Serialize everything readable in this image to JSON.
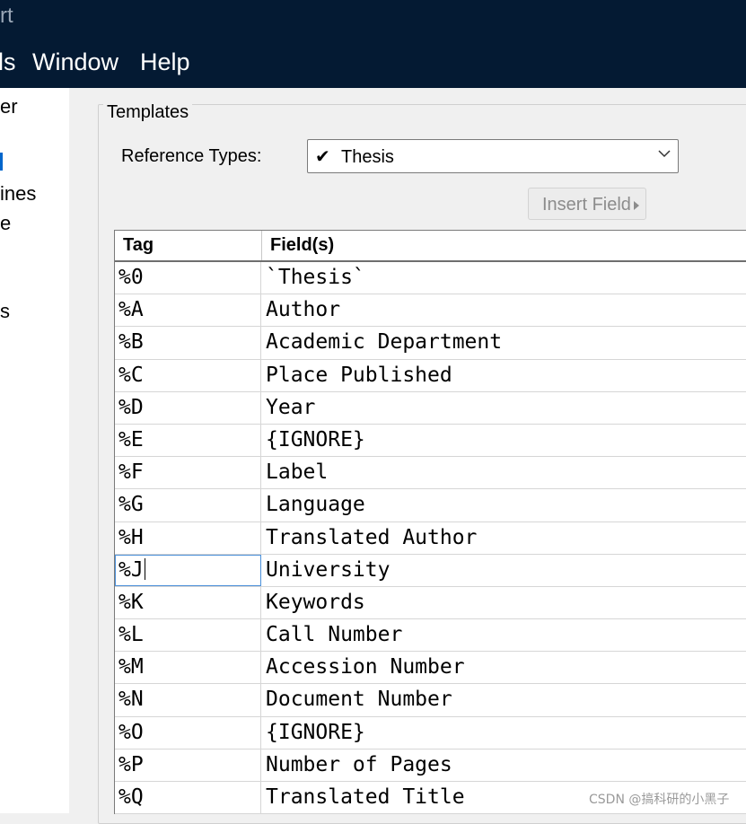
{
  "window": {
    "title_fragment": "rt"
  },
  "menubar": {
    "items": [
      "ls",
      "Window",
      "Help"
    ]
  },
  "sidebar": {
    "items": [
      {
        "label": "er",
        "selected": false
      },
      {
        "label": "",
        "selected": true
      },
      {
        "label": "ines",
        "selected": false
      },
      {
        "label": "e",
        "selected": false
      },
      {
        "label": "s",
        "selected": false
      }
    ]
  },
  "templates": {
    "group_label": "Templates",
    "reference_types_label": "Reference Types:",
    "reference_type_value": "Thesis",
    "insert_field_label": "Insert Field",
    "insert_field_enabled": false,
    "columns": {
      "tag": "Tag",
      "fields": "Field(s)"
    },
    "rows": [
      {
        "tag": "%0",
        "field": "`Thesis`"
      },
      {
        "tag": "%A",
        "field": "Author"
      },
      {
        "tag": "%B",
        "field": "Academic Department"
      },
      {
        "tag": "%C",
        "field": "Place Published"
      },
      {
        "tag": "%D",
        "field": "Year"
      },
      {
        "tag": "%E",
        "field": "{IGNORE}"
      },
      {
        "tag": "%F",
        "field": "Label"
      },
      {
        "tag": "%G",
        "field": "Language"
      },
      {
        "tag": "%H",
        "field": "Translated Author"
      },
      {
        "tag": "%J",
        "field": "University"
      },
      {
        "tag": "%K",
        "field": "Keywords"
      },
      {
        "tag": "%L",
        "field": "Call Number"
      },
      {
        "tag": "%M",
        "field": "Accession Number"
      },
      {
        "tag": "%N",
        "field": "Document Number"
      },
      {
        "tag": "%O",
        "field": "{IGNORE}"
      },
      {
        "tag": "%P",
        "field": "Number of Pages"
      },
      {
        "tag": "%Q",
        "field": "Translated Title"
      }
    ],
    "focused_row": 9
  },
  "watermark": "CSDN @搞科研的小黑子",
  "colors": {
    "titlebar": "#041a33",
    "accent": "#0066cc",
    "focus": "#4a90d9"
  }
}
